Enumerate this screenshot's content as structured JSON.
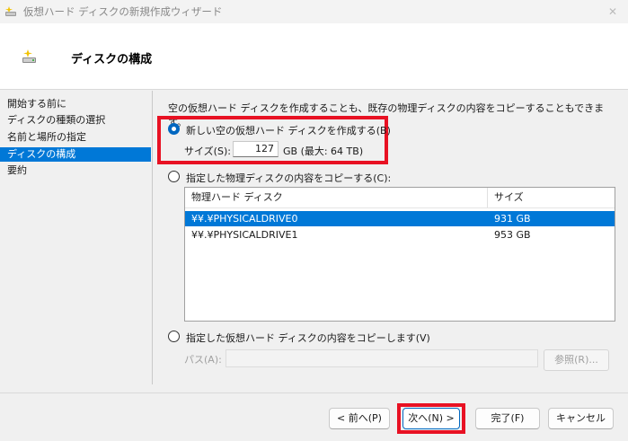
{
  "window": {
    "title": "仮想ハード ディスクの新規作成ウィザード",
    "close_glyph": "✕"
  },
  "header": {
    "title": "ディスクの構成"
  },
  "nav": {
    "items": [
      {
        "label": "開始する前に",
        "active": false
      },
      {
        "label": "ディスクの種類の選択",
        "active": false
      },
      {
        "label": "名前と場所の指定",
        "active": false
      },
      {
        "label": "ディスクの構成",
        "active": true
      },
      {
        "label": "要約",
        "active": false
      }
    ]
  },
  "content": {
    "intro": "空の仮想ハード ディスクを作成することも、既存の物理ディスクの内容をコピーすることもできます。",
    "option_new": {
      "label": "新しい空の仮想ハード ディスクを作成する(B)",
      "selected": true,
      "size_label": "サイズ(S):",
      "size_value": "127",
      "size_unit": "GB (最大: 64 TB)"
    },
    "option_physical": {
      "label": "指定した物理ディスクの内容をコピーする(C):",
      "selected": false,
      "columns": [
        "物理ハード ディスク",
        "サイズ"
      ],
      "rows": [
        {
          "name": "¥¥.¥PHYSICALDRIVE0",
          "size": "931 GB",
          "selected": true
        },
        {
          "name": "¥¥.¥PHYSICALDRIVE1",
          "size": "953 GB",
          "selected": false
        }
      ]
    },
    "option_virtual": {
      "label": "指定した仮想ハード ディスクの内容をコピーします(V)",
      "selected": false,
      "path_label": "パス(A):",
      "path_value": "",
      "browse_label": "参照(R)..."
    }
  },
  "footer": {
    "prev_label": "< 前へ(P)",
    "next_label": "次へ(N) >",
    "finish_label": "完了(F)",
    "cancel_label": "キャンセル"
  },
  "colors": {
    "accent": "#0078d7",
    "highlight_box": "#e81123"
  }
}
